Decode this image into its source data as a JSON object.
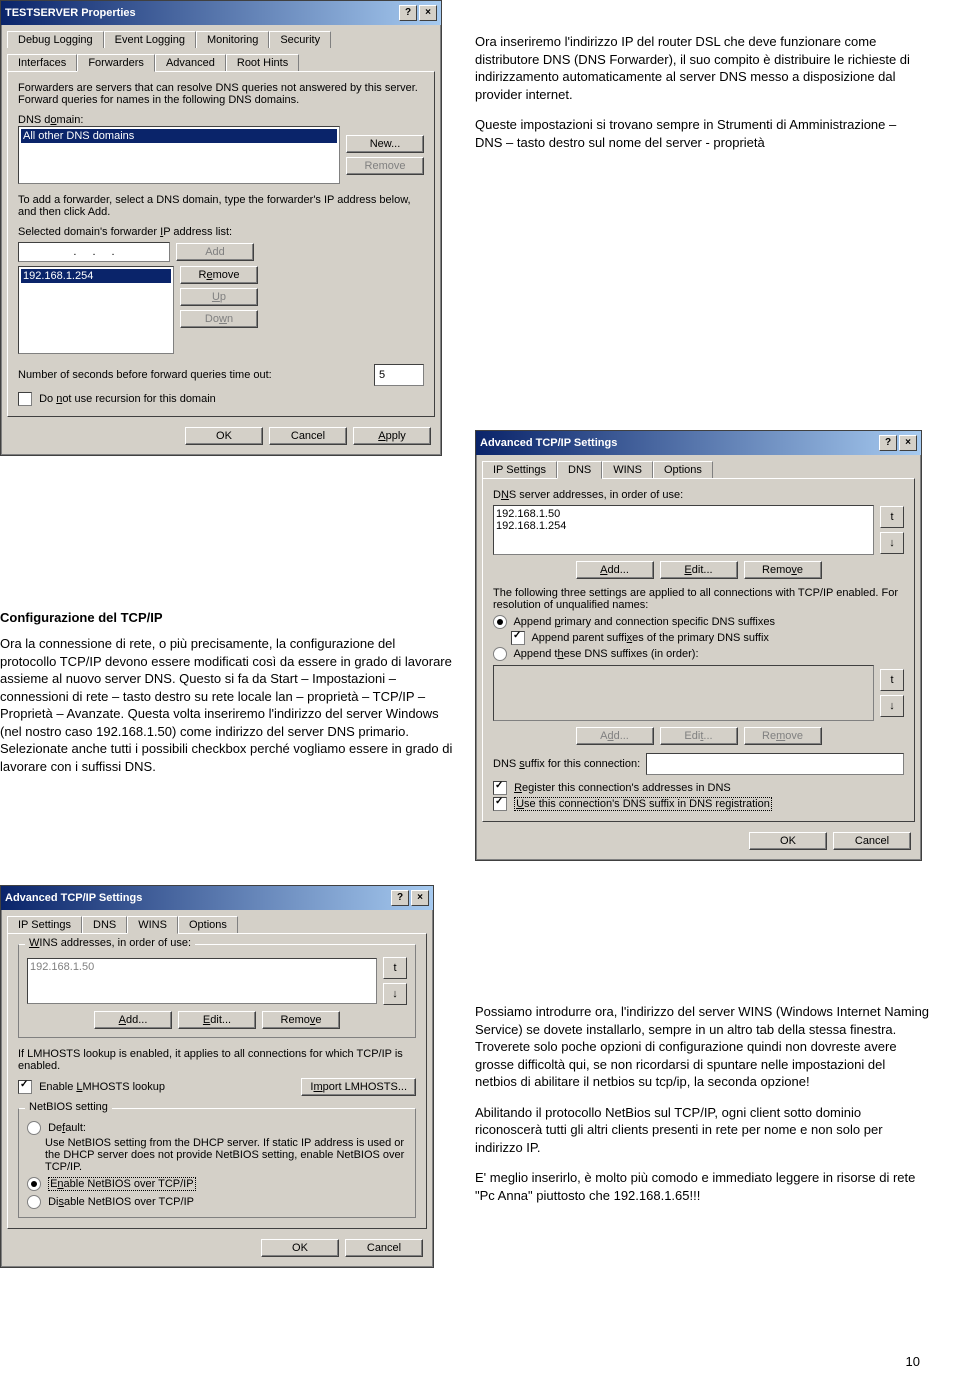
{
  "page_number": "10",
  "article1": {
    "p1": "Ora inseriremo l'indirizzo IP del router DSL che deve funzionare come distributore DNS (DNS Forwarder), il suo compito è distribuire le richieste di indirizzamento automaticamente al server DNS messo a disposizione dal provider internet.",
    "p2": "Queste impostazioni si trovano sempre in Strumenti di Amministrazione – DNS – tasto destro sul nome del server - proprietà"
  },
  "article2": {
    "heading": "Configurazione del TCP/IP",
    "p1": "Ora la connessione di rete, o più precisamente, la configurazione del protocollo TCP/IP devono essere modificati così da essere in grado di lavorare assieme al nuovo server DNS. Questo si fa da Start – Impostazioni – connessioni di rete – tasto destro su rete locale lan – proprietà – TCP/IP – Proprietà – Avanzate. Questa volta inseriremo l'indirizzo del server Windows (nel nostro caso 192.168.1.50) come indirizzo del server DNS primario. Selezionate anche tutti i possibili checkbox perché vogliamo essere in grado di lavorare con i suffissi DNS."
  },
  "article3": {
    "p1": "Possiamo introdurre ora, l'indirizzo del server WINS (Windows Internet Naming Service) se dovete installarlo, sempre in un altro tab della stessa finestra. Troverete solo poche opzioni di configurazione quindi non dovreste avere grosse difficoltà qui, se non ricordarsi di spuntare nelle impostazioni del netbios di abilitare il netbios su tcp/ip, la seconda opzione!",
    "p2": "Abilitando il protocollo NetBios sul TCP/IP, ogni client sotto dominio riconoscerà tutti gli altri clients presenti in rete per nome e non solo per indirizzo IP.",
    "p3": "E' meglio inserirlo, è molto più comodo e immediato leggere in risorse di rete \"Pc Anna\" piuttosto che 192.168.1.65!!!"
  },
  "dlg1": {
    "title": "TESTSERVER Properties",
    "tabs_row1": [
      "Debug Logging",
      "Event Logging",
      "Monitoring",
      "Security"
    ],
    "tabs_row2": [
      "Interfaces",
      "Forwarders",
      "Advanced",
      "Root Hints"
    ],
    "intro": "Forwarders are servers that can resolve DNS queries not answered by this server. Forward queries for names in the following DNS domains.",
    "dns_domain_label": "DNS domain:",
    "domain_item": "All other DNS domains",
    "new_btn": "New...",
    "remove_btn": "Remove",
    "help_text": "To add a forwarder, select a DNS domain, type the forwarder's IP address below, and then click Add.",
    "ip_list_label": "Selected domain's forwarder IP address list:",
    "add_btn": "Add",
    "remove2_btn": "Remove",
    "up_btn": "Up",
    "down_btn": "Down",
    "ip_value": "192.168.1.254",
    "timeout_label": "Number of seconds before forward queries time out:",
    "timeout_value": "5",
    "no_recursion": "Do not use recursion for this domain",
    "ok": "OK",
    "cancel": "Cancel",
    "apply": "Apply"
  },
  "dlg2": {
    "title": "Advanced TCP/IP Settings",
    "tabs": [
      "IP Settings",
      "DNS",
      "WINS",
      "Options"
    ],
    "dns_label": "DNS server addresses, in order of use:",
    "servers": [
      "192.168.1.50",
      "192.168.1.254"
    ],
    "add": "Add...",
    "edit": "Edit...",
    "remove": "Remove",
    "applies": "The following three settings are applied to all connections with TCP/IP enabled. For resolution of unqualified names:",
    "r1": "Append primary and connection specific DNS suffixes",
    "c1": "Append parent suffixes of the primary DNS suffix",
    "r2": "Append these DNS suffixes (in order):",
    "add2": "Add...",
    "edit2": "Edit...",
    "remove2": "Remove",
    "suffix_label": "DNS suffix for this connection:",
    "c2": "Register this connection's addresses in DNS",
    "c3": "Use this connection's DNS suffix in DNS registration",
    "ok": "OK",
    "cancel": "Cancel"
  },
  "dlg3": {
    "title": "Advanced TCP/IP Settings",
    "tabs": [
      "IP Settings",
      "DNS",
      "WINS",
      "Options"
    ],
    "wins_label": "WINS addresses, in order of use:",
    "wins_ip": "192.168.1.50",
    "add": "Add...",
    "edit": "Edit...",
    "remove": "Remove",
    "lmhosts_help": "If LMHOSTS lookup is enabled, it applies to all connections for which TCP/IP is enabled.",
    "enable_lmhosts": "Enable LMHOSTS lookup",
    "import": "Import LMHOSTS...",
    "group_title": "NetBIOS setting",
    "r_default": "Default:",
    "r_default_help": "Use NetBIOS setting from the DHCP server. If static IP address is used or the DHCP server does not provide NetBIOS setting, enable NetBIOS over TCP/IP.",
    "r_enable": "Enable NetBIOS over TCP/IP",
    "r_disable": "Disable NetBIOS over TCP/IP",
    "ok": "OK",
    "cancel": "Cancel"
  }
}
